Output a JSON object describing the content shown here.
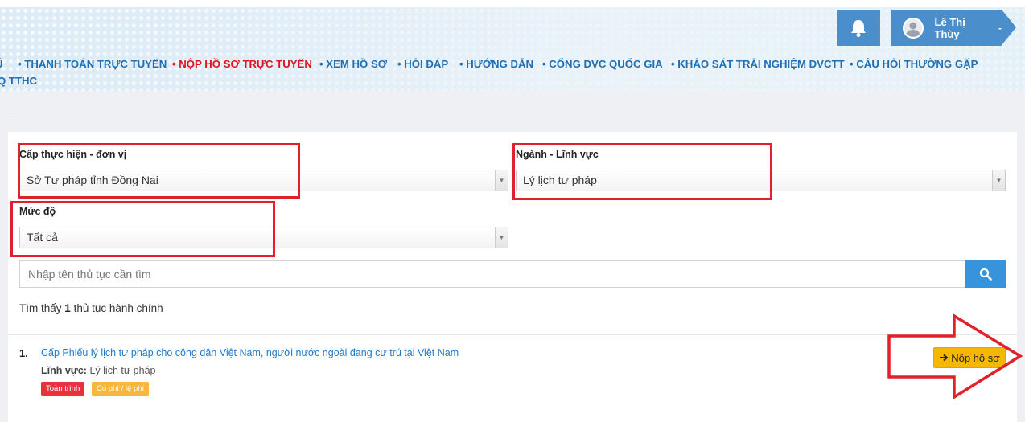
{
  "header": {
    "user_name": "Lê Thị Thùy",
    "user_caret": "-",
    "nav_items": [
      {
        "label": "Ú",
        "active": false
      },
      {
        "label": "• THANH TOÁN TRỰC TUYẾN",
        "active": false
      },
      {
        "label": "• NỘP HỒ SƠ TRỰC TUYẾN",
        "active": true
      },
      {
        "label": "• XEM HỒ SƠ",
        "active": false
      },
      {
        "label": "• HỎI ĐÁP",
        "active": false
      },
      {
        "label": "• HƯỚNG DẪN",
        "active": false
      },
      {
        "label": "• CỔNG DVC QUỐC GIA",
        "active": false
      },
      {
        "label": "• KHẢO SÁT TRẢI NGHIỆM DVCTT",
        "active": false
      },
      {
        "label": "• CÂU HỎI THƯỜNG GẶP",
        "active": false
      }
    ],
    "nav_second_line": "Q TTHC"
  },
  "filters": {
    "level_label": "Cấp thực hiện - đơn vị",
    "level_value": "Sở Tư pháp tỉnh Đồng Nai",
    "sector_label": "Ngành - Lĩnh vực",
    "sector_value": "Lý lịch tư pháp",
    "degree_label": "Mức độ",
    "degree_value": "Tất cả"
  },
  "search": {
    "placeholder": "Nhập tên thủ tục cần tìm"
  },
  "results": {
    "prefix": "Tìm thấy",
    "count": "1",
    "suffix": "thủ tục hành chính",
    "items": [
      {
        "number": "1.",
        "title": "Cấp Phiếu lý lịch tư pháp cho công dân Việt Nam, người nước ngoài đang cư trú tại Việt Nam",
        "field_label": "Lĩnh vực:",
        "field_value": "Lý lịch tư pháp",
        "badge_full": "Toàn trình",
        "badge_fee": "Có phí / lệ phí",
        "submit_label": "Nộp hồ sơ"
      }
    ]
  },
  "colors": {
    "accent": "#3793dc",
    "active_nav": "#e0141e",
    "nav": "#1f6fb2",
    "annotation": "#e2202a",
    "submit": "#f5b800"
  }
}
